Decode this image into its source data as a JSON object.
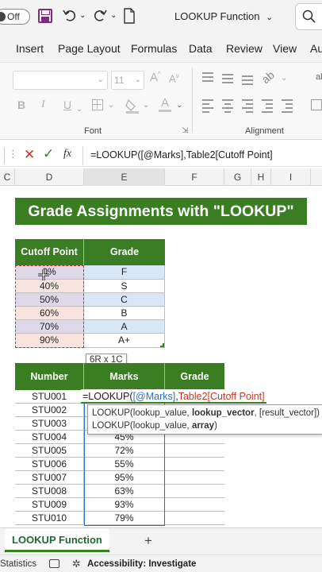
{
  "titlebar": {
    "autosave_label": "Off",
    "document_title": "LOOKUP Function",
    "title_chevron": "⌄"
  },
  "menu": {
    "items": [
      "Insert",
      "Page Layout",
      "Formulas",
      "Data",
      "Review",
      "View",
      "Au"
    ]
  },
  "ribbon": {
    "font_size": "11",
    "bold": "B",
    "italic": "I",
    "underline": "U",
    "font_group_label": "Font",
    "alignment_group_label": "Alignment",
    "font_color_letter": "A",
    "partial_right": "ab",
    "partial_right2": "⇲"
  },
  "formula_bar": {
    "fx": "fx",
    "formula": "=LOOKUP([@Marks],Table2[Cutoff Point]"
  },
  "columns": [
    "C",
    "D",
    "E",
    "F",
    "G",
    "H",
    "I"
  ],
  "sheet": {
    "banner_title": "Grade Assignments with \"LOOKUP\"",
    "table1": {
      "headers": [
        "Cutoff Point",
        "Grade"
      ],
      "rows": [
        [
          "0%",
          "F"
        ],
        [
          "40%",
          "S"
        ],
        [
          "50%",
          "C"
        ],
        [
          "60%",
          "B"
        ],
        [
          "70%",
          "A"
        ],
        [
          "90%",
          "A+"
        ]
      ]
    },
    "selection_badge": "6R x 1C",
    "table2": {
      "headers": [
        "Number",
        "Marks",
        "Grade"
      ],
      "rows": [
        [
          "STU001",
          ""
        ],
        [
          "STU002",
          ""
        ],
        [
          "STU003",
          ""
        ],
        [
          "STU004",
          "45%"
        ],
        [
          "STU005",
          "72%"
        ],
        [
          "STU006",
          "55%"
        ],
        [
          "STU007",
          "95%"
        ],
        [
          "STU008",
          "63%"
        ],
        [
          "STU009",
          "93%"
        ],
        [
          "STU010",
          "79%"
        ]
      ]
    },
    "edit_formula": {
      "prefix": "=LOOKUP(",
      "arg1": "[@Marks]",
      "comma": ",",
      "arg2": "Table2[Cutoff Point]"
    },
    "tooltip": {
      "line1_func": "LOOKUP(lookup_value, ",
      "line1_bold": "lookup_vector",
      "line1_rest": ", [result_vector])",
      "line2_func": "LOOKUP(lookup_value, ",
      "line2_bold": "array",
      "line2_rest": ")"
    }
  },
  "tabs": {
    "active_sheet": "LOOKUP Function",
    "add": "+"
  },
  "status": {
    "statistics": "Statistics",
    "accessibility": "Accessibility: Investigate"
  },
  "colors": {
    "header_green": "#3a7d22",
    "cutoff_fill": "#f8dbd8",
    "grade_fill": "#d9e7f5",
    "ref_blue": "#2f6fbf",
    "ref_red": "#c0392b"
  }
}
